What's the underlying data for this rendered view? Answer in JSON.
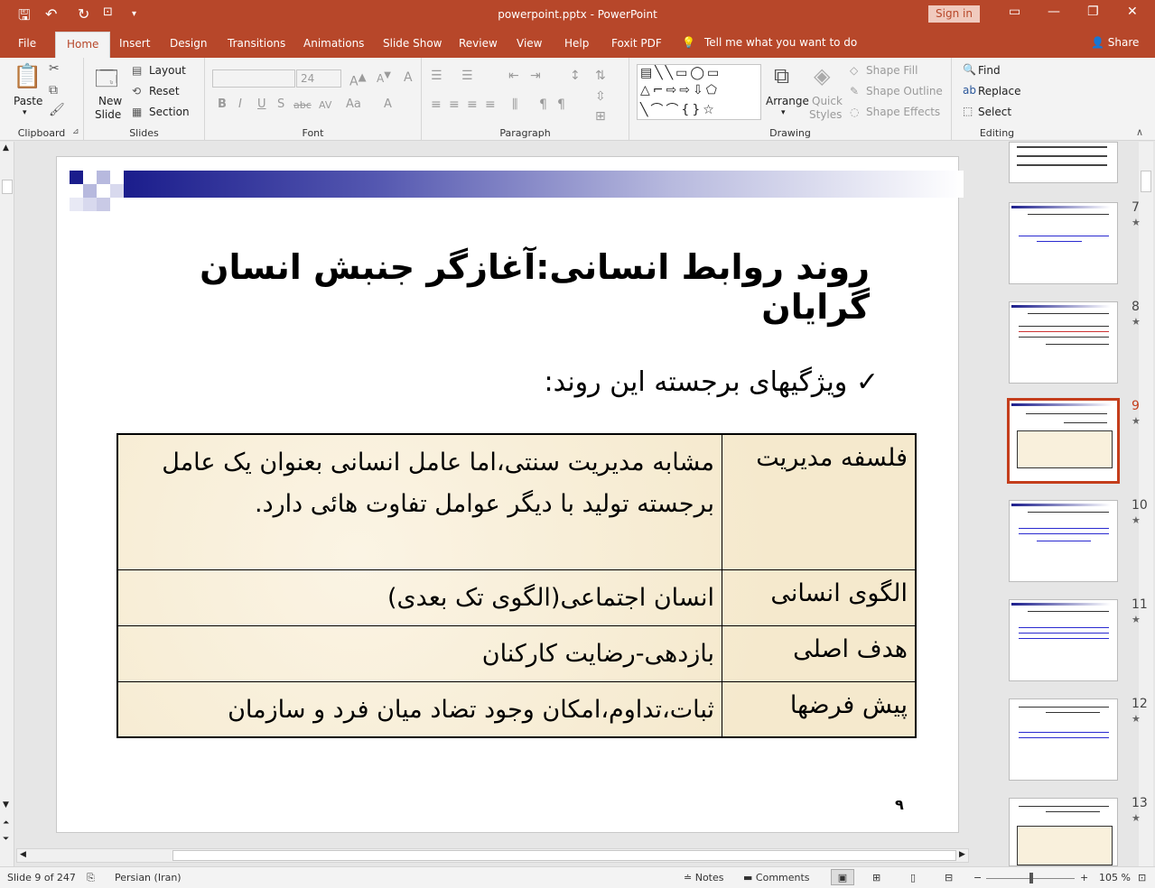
{
  "titlebar": {
    "title": "powerpoint.pptx  -  PowerPoint",
    "signin": "Sign in"
  },
  "tabs": [
    "File",
    "Home",
    "Insert",
    "Design",
    "Transitions",
    "Animations",
    "Slide Show",
    "Review",
    "View",
    "Help",
    "Foxit PDF"
  ],
  "tell_me": "Tell me what you want to do",
  "share": "Share",
  "ribbon": {
    "clipboard": {
      "label": "Clipboard",
      "paste": "Paste"
    },
    "slides": {
      "label": "Slides",
      "new_slide": "New",
      "new_slide2": "Slide",
      "layout": "Layout",
      "reset": "Reset",
      "section": "Section"
    },
    "font": {
      "label": "Font",
      "size": "24"
    },
    "paragraph": {
      "label": "Paragraph"
    },
    "drawing": {
      "label": "Drawing",
      "arrange": "Arrange",
      "quick": "Quick",
      "styles": "Styles",
      "fill": "Shape Fill",
      "outline": "Shape Outline",
      "effects": "Shape Effects"
    },
    "editing": {
      "label": "Editing",
      "find": "Find",
      "replace": "Replace",
      "select": "Select"
    }
  },
  "slide": {
    "title": "روند روابط انسانی:آغازگر جنبش انسان گرایان",
    "bullet": "ویژگیهای برجسته این روند:",
    "rows": [
      {
        "label": "فلسفه مدیریت",
        "value": "مشابه مدیریت سنتی،اما عامل انسانی بعنوان یک عامل برجسته تولید با دیگر عوامل تفاوت هائی دارد."
      },
      {
        "label": "الگوی انسانی",
        "value": "انسان اجتماعی(الگوی تک بعدی)"
      },
      {
        "label": "هدف اصلی",
        "value": "بازدهی-رضایت کارکنان"
      },
      {
        "label": "پیش فرضها",
        "value": "ثبات،تداوم،امکان وجود تضاد میان فرد و سازمان"
      }
    ],
    "page_number": "٩"
  },
  "thumbnails": {
    "numbers": [
      "7",
      "8",
      "9",
      "10",
      "11",
      "12",
      "13"
    ],
    "selected": "9"
  },
  "status": {
    "slide": "Slide 9 of 247",
    "language": "Persian (Iran)",
    "notes": "Notes",
    "comments": "Comments",
    "zoom": "105 %"
  },
  "colors": {
    "accent": "#b7472a",
    "selected_thumb": "#c43e1c"
  }
}
